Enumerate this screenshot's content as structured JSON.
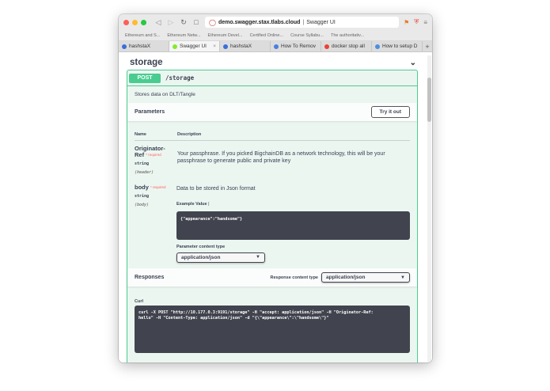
{
  "browser": {
    "url_host": "demo.swagger.stax.tlabs.cloud",
    "url_sep": "|",
    "page_title": "Swagger UI",
    "bookmarks": [
      "Ethereum and S...",
      "Ethereum Netw...",
      "Ethereum Devel...",
      "Certified Online...",
      "Course Syllabu...",
      "The authoritativ..."
    ],
    "tabs": [
      {
        "label": "hashstaX",
        "color": "#3a6fd8"
      },
      {
        "label": "Swagger UI",
        "color": "#85ea2d"
      },
      {
        "label": "hashstaX",
        "color": "#3a6fd8"
      },
      {
        "label": "How To Remov",
        "color": "#4a7fe0"
      },
      {
        "label": "docker stop all",
        "color": "#ea4335"
      },
      {
        "label": "How to setup D",
        "color": "#4a90e2"
      }
    ]
  },
  "section": {
    "title": "storage"
  },
  "operation": {
    "method": "POST",
    "path": "/storage",
    "description": "Stores data on DLT/Tangle"
  },
  "parameters": {
    "title": "Parameters",
    "try_button": "Try it out",
    "col_name": "Name",
    "col_desc": "Description",
    "items": [
      {
        "name_line1": "Originator-",
        "name_line2": "Ref",
        "required": "* required",
        "type": "string",
        "in": "(header)",
        "description": "Your passphrase. If you picked BigchainDB as a network technology, this will be your passphrase to generate public and private key"
      },
      {
        "name": "body",
        "required": "* required",
        "type": "string",
        "in": "(body)",
        "description": "Data to be stored in Json format",
        "example_label": "Example Value",
        "example_sep": "|",
        "example_value": "{\"appearance\":\"handsome\"}",
        "content_type_label": "Parameter content type",
        "content_type": "application/json"
      }
    ]
  },
  "responses": {
    "title": "Responses",
    "content_type_label": "Response content type",
    "content_type": "application/json",
    "curl_label": "Curl",
    "curl_line1": "curl -X POST \"http://10.177.0.3:9191/storage\" -H \"accept: application/json\" -H \"Originator-Ref:",
    "curl_line2": "hello\" -H \"Content-Type: application/json\" -d \"{\\\"appearance\\\":\\\"handsome\\\"}\""
  }
}
